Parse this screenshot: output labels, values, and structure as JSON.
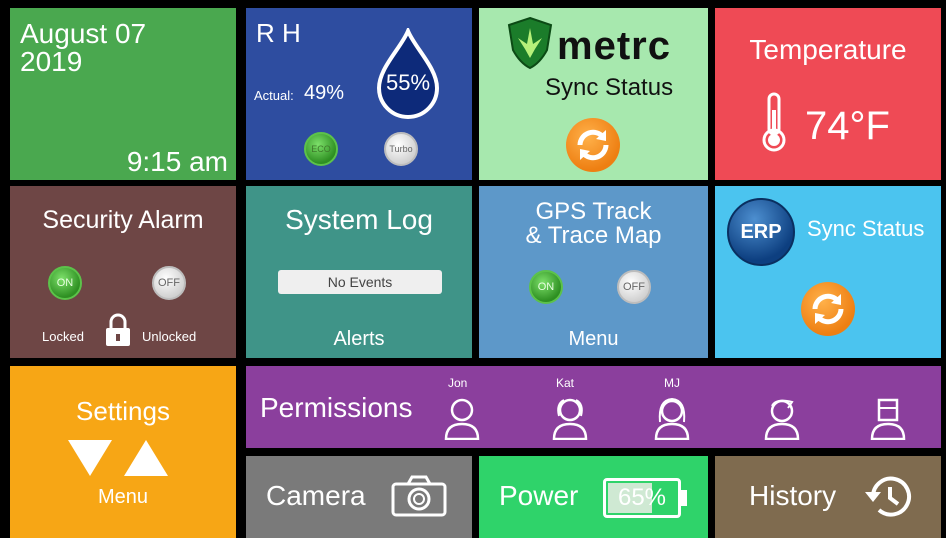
{
  "date": {
    "month_day": "August 07",
    "year": "2019",
    "time": "9:15 am"
  },
  "rh": {
    "title": "R H",
    "actual_label": "Actual:",
    "actual_value": "49%",
    "drop_value": "55%",
    "eco_label": "ECO",
    "turbo_label": "Turbo"
  },
  "metrc": {
    "logo_text": "metrc",
    "status": "Sync Status"
  },
  "temperature": {
    "title": "Temperature",
    "value": "74°F"
  },
  "security": {
    "title": "Security Alarm",
    "on_label": "ON",
    "off_label": "OFF",
    "locked_label": "Locked",
    "unlocked_label": "Unlocked"
  },
  "system_log": {
    "title": "System Log",
    "events": "No Events",
    "footer": "Alerts"
  },
  "gps": {
    "title_line1": "GPS Track",
    "title_line2": "& Trace Map",
    "on_label": "ON",
    "off_label": "OFF",
    "footer": "Menu"
  },
  "erp": {
    "logo_text": "ERP",
    "status": "Sync Status"
  },
  "settings": {
    "title": "Settings",
    "footer": "Menu"
  },
  "permissions": {
    "title": "Permissions",
    "users": [
      "Jon",
      "Kat",
      "MJ",
      "",
      ""
    ]
  },
  "camera": {
    "label": "Camera"
  },
  "power": {
    "label": "Power",
    "battery": "65%",
    "battery_level": 0.65
  },
  "history": {
    "label": "History"
  },
  "colors": {
    "date": "#4aa84f",
    "rh": "#2e4da0",
    "metrc": "#a7e8ae",
    "temperature": "#ef4a55",
    "security": "#6e4645",
    "system_log": "#3f9488",
    "gps": "#5d98c9",
    "erp": "#4bc4ef",
    "settings": "#f7a615",
    "permissions": "#8b3f9d",
    "camera": "#7a7a7a",
    "power": "#2fd36a",
    "history": "#7f6b4f"
  }
}
